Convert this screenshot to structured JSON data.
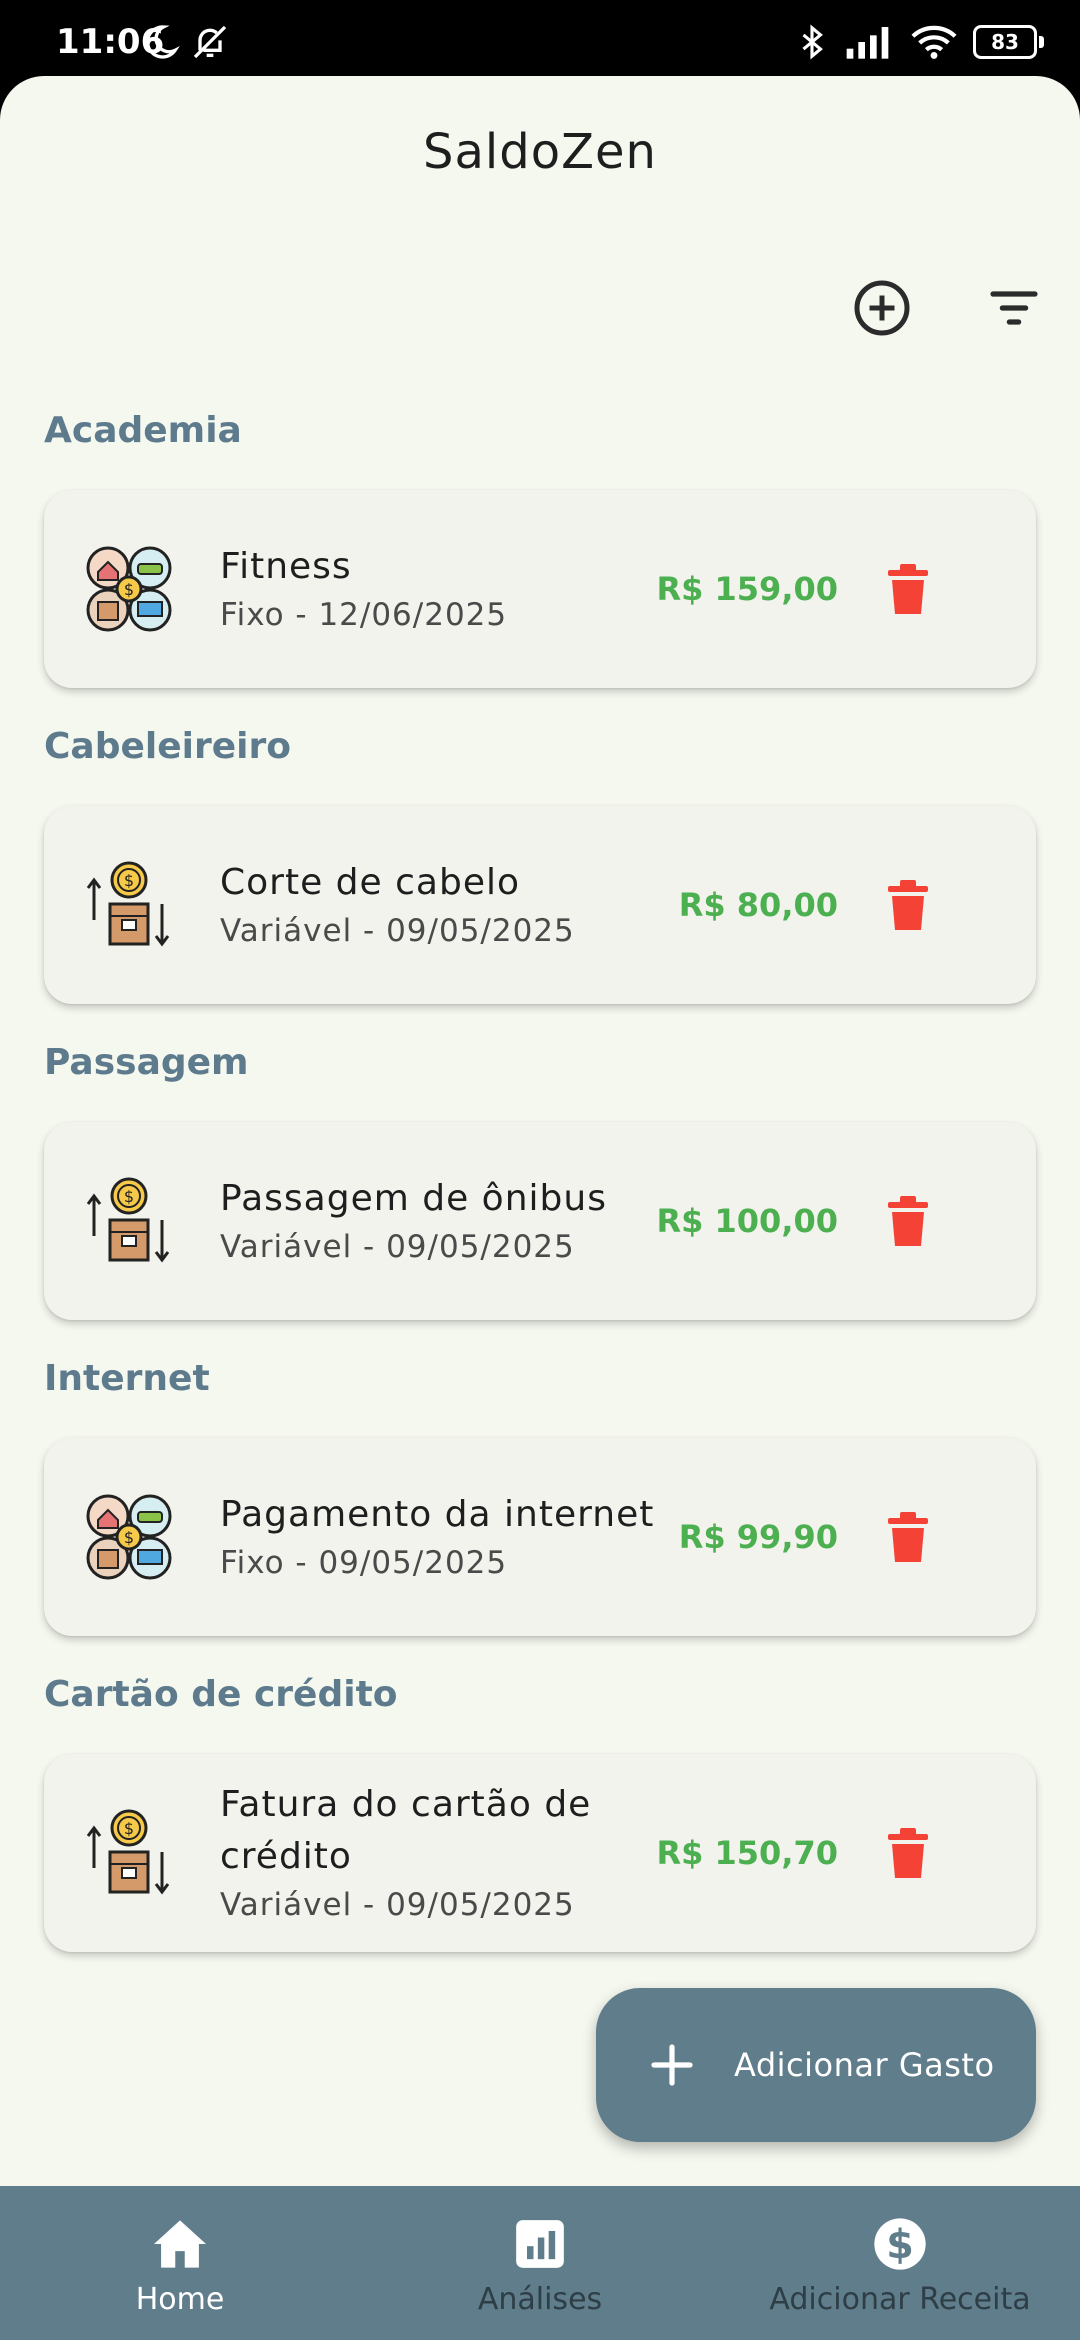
{
  "status_bar": {
    "time": "11:06",
    "battery": "83"
  },
  "app": {
    "title": "SaldoZen"
  },
  "toolbar": {
    "add_icon": "add-circle-icon",
    "filter_icon": "filter-list-icon"
  },
  "sections": [
    {
      "title": "Academia",
      "item": {
        "name": "Fitness",
        "subtitle": "Fixo - 12/06/2025",
        "amount": "R$ 159,00",
        "icon": "bills-icon"
      }
    },
    {
      "title": "Cabeleireiro",
      "item": {
        "name": "Corte de cabelo",
        "subtitle": "Variável - 09/05/2025",
        "amount": "R$ 80,00",
        "icon": "cashflow-icon"
      }
    },
    {
      "title": "Passagem",
      "item": {
        "name": "Passagem de ônibus",
        "subtitle": "Variável - 09/05/2025",
        "amount": "R$ 100,00",
        "icon": "cashflow-icon"
      }
    },
    {
      "title": "Internet",
      "item": {
        "name": "Pagamento da internet",
        "subtitle": "Fixo - 09/05/2025",
        "amount": "R$ 99,90",
        "icon": "bills-icon"
      }
    },
    {
      "title": "Cartão de crédito",
      "item": {
        "name": "Fatura do cartão de crédito",
        "subtitle": "Variável - 09/05/2025",
        "amount": "R$ 150,70",
        "icon": "cashflow-icon"
      }
    }
  ],
  "fab": {
    "label": "Adicionar Gasto"
  },
  "bottom_nav": {
    "items": [
      {
        "label": "Home",
        "icon": "home-icon",
        "active": true
      },
      {
        "label": "Análises",
        "icon": "analytics-icon",
        "active": false
      },
      {
        "label": "Adicionar Receita",
        "icon": "dollar-circle-icon",
        "active": false
      }
    ]
  },
  "colors": {
    "background": "#f5f8ef",
    "card": "#f1f3ec",
    "accent": "#607d8b",
    "section_title": "#5e7b8d",
    "amount": "#4caf50",
    "delete": "#f44336"
  }
}
